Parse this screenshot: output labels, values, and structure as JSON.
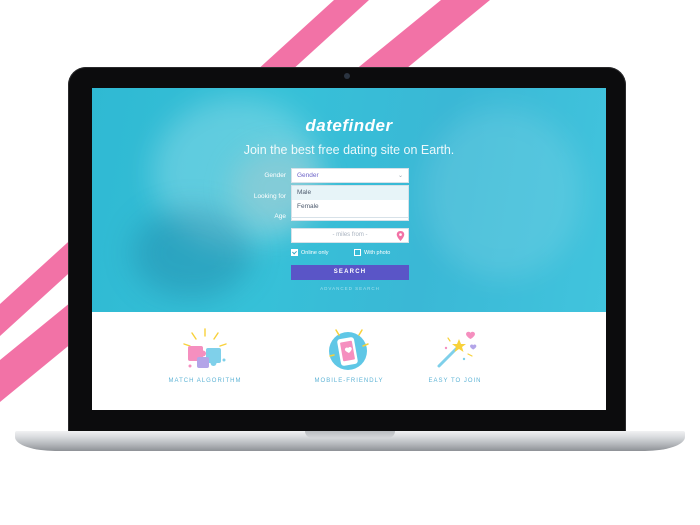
{
  "brand": {
    "logo_text": "datefinder",
    "tagline": "Join the best free dating site on Earth."
  },
  "form": {
    "gender_label": "Gender",
    "gender_value": "Gender",
    "looking_label": "Looking for",
    "age_label": "Age",
    "options": [
      "Male",
      "Female"
    ],
    "location_placeholder": "- miles from -",
    "online_only_label": "Online only",
    "online_only_checked": true,
    "with_photo_label": "With photo",
    "with_photo_checked": false,
    "search_label": "SEARCH",
    "advanced_label": "ADVANCED SEARCH"
  },
  "features": [
    {
      "label": "MATCH ALGORITHM",
      "icon": "puzzle-icon"
    },
    {
      "label": "MOBILE-FRIENDLY",
      "icon": "phone-icon"
    },
    {
      "label": "EASY TO JOIN",
      "icon": "magic-wand-icon"
    }
  ],
  "colors": {
    "stripe": "#f272a6",
    "hero": "#36c1d8",
    "button": "#5a55c7",
    "feature_text": "#5fb4d6"
  }
}
